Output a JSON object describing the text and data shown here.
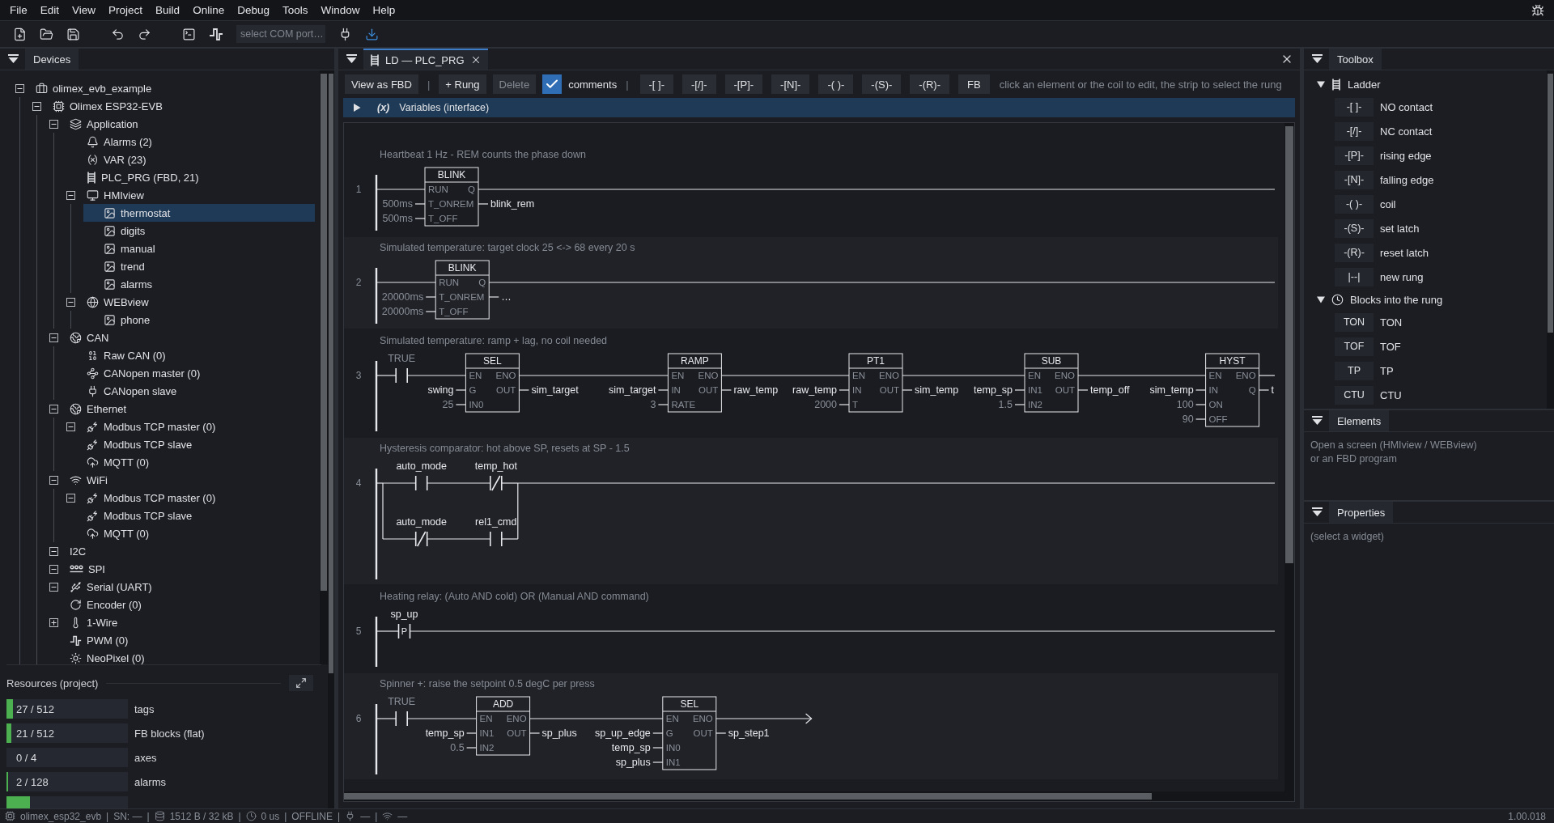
{
  "menu": [
    "File",
    "Edit",
    "View",
    "Project",
    "Build",
    "Online",
    "Debug",
    "Tools",
    "Window",
    "Help"
  ],
  "toolbar": {
    "port_select": {
      "placeholder": "select COM port…"
    }
  },
  "devices": {
    "title": "Devices",
    "tree": [
      {
        "label": "olimex_evb_example",
        "kind": "project",
        "expanded": true,
        "selected": false,
        "children": [
          {
            "label": "Olimex ESP32-EVB",
            "kind": "board",
            "expanded": true,
            "selected": false,
            "children": [
              {
                "label": "Application",
                "kind": "application",
                "expanded": true,
                "selected": false,
                "children": [
                  {
                    "label": "Alarms (2)",
                    "kind": "alarms",
                    "selected": false
                  },
                  {
                    "label": "VAR (23)",
                    "kind": "variables",
                    "selected": false
                  },
                  {
                    "label": "PLC_PRG (FBD, 21)",
                    "kind": "program",
                    "selected": false
                  },
                  {
                    "label": "HMIview",
                    "kind": "screens",
                    "expanded": true,
                    "selected": false,
                    "children": [
                      {
                        "label": "thermostat",
                        "kind": "screen",
                        "selected": true
                      },
                      {
                        "label": "digits",
                        "kind": "screen",
                        "selected": false
                      },
                      {
                        "label": "manual",
                        "kind": "screen",
                        "selected": false
                      },
                      {
                        "label": "trend",
                        "kind": "screen",
                        "selected": false
                      },
                      {
                        "label": "alarms",
                        "kind": "screen",
                        "selected": false
                      }
                    ]
                  },
                  {
                    "label": "WEBview",
                    "kind": "web",
                    "expanded": true,
                    "selected": false,
                    "children": [
                      {
                        "label": "phone",
                        "kind": "screen",
                        "selected": false
                      }
                    ]
                  }
                ]
              },
              {
                "label": "CAN",
                "kind": "bus",
                "expanded": true,
                "selected": false,
                "children": [
                  {
                    "label": "Raw CAN (0)",
                    "kind": "raw",
                    "selected": false
                  },
                  {
                    "label": "CANopen master (0)",
                    "kind": "master",
                    "selected": false
                  },
                  {
                    "label": "CANopen slave",
                    "kind": "slave",
                    "selected": false
                  }
                ]
              },
              {
                "label": "Ethernet",
                "kind": "bus",
                "expanded": true,
                "selected": false,
                "children": [
                  {
                    "label": "Modbus TCP master (0)",
                    "kind": "modbus",
                    "expanded": true,
                    "selected": false
                  },
                  {
                    "label": "Modbus TCP slave",
                    "kind": "modbus",
                    "selected": false
                  },
                  {
                    "label": "MQTT (0)",
                    "kind": "mqtt",
                    "selected": false
                  }
                ]
              },
              {
                "label": "WiFi",
                "kind": "wifi",
                "expanded": true,
                "selected": false,
                "children": [
                  {
                    "label": "Modbus TCP master (0)",
                    "kind": "modbus",
                    "expanded": true,
                    "selected": false
                  },
                  {
                    "label": "Modbus TCP slave",
                    "kind": "modbus",
                    "selected": false
                  },
                  {
                    "label": "MQTT (0)",
                    "kind": "mqtt",
                    "selected": false
                  }
                ]
              },
              {
                "label": "I2C",
                "kind": "interface",
                "expanded": true,
                "selected": false
              },
              {
                "label": "SPI",
                "kind": "spi",
                "expanded": true,
                "selected": false
              },
              {
                "label": "Serial (UART)",
                "kind": "serial",
                "expanded": true,
                "selected": false
              },
              {
                "label": "Encoder (0)",
                "kind": "encoder",
                "selected": false
              },
              {
                "label": "1-Wire",
                "kind": "onewire",
                "expanded": false,
                "selected": false
              },
              {
                "label": "PWM (0)",
                "kind": "pwm",
                "selected": false
              },
              {
                "label": "NeoPixel (0)",
                "kind": "led",
                "selected": false
              }
            ]
          }
        ]
      }
    ]
  },
  "resources": {
    "title": "Resources (project)",
    "items": [
      {
        "value": "27 / 512",
        "label": "tags",
        "level": 0.053
      },
      {
        "value": "21 / 512",
        "label": "FB blocks (flat)",
        "level": 0.041
      },
      {
        "value": "0 / 4",
        "label": "axes"
      },
      {
        "value": "2 / 128",
        "label": "alarms",
        "level": 0.016
      },
      {
        "level": 0.19
      }
    ]
  },
  "editor": {
    "tab": {
      "title": "LD — PLC_PRG",
      "selected": true
    },
    "toolbar": [
      {
        "kind": "button",
        "label": "View as FBD",
        "disabled": false
      },
      {
        "kind": "separator",
        "label": "|"
      },
      {
        "kind": "button",
        "label": "+ Rung",
        "disabled": false
      },
      {
        "kind": "button",
        "label": "Delete",
        "disabled": true
      },
      {
        "kind": "checkbox",
        "label": "comments",
        "checked": true
      },
      {
        "kind": "separator",
        "label": "|"
      },
      {
        "kind": "element",
        "label": "-[ ]-",
        "disabled": false
      },
      {
        "kind": "element",
        "label": "-[/]-",
        "disabled": false
      },
      {
        "kind": "element",
        "label": "-[P]-",
        "disabled": false
      },
      {
        "kind": "element",
        "label": "-[N]-",
        "disabled": false
      },
      {
        "kind": "element",
        "label": "-( )-",
        "disabled": false
      },
      {
        "kind": "element",
        "label": "-(S)-",
        "disabled": false
      },
      {
        "kind": "element",
        "label": "-(R)-",
        "disabled": false
      },
      {
        "kind": "element",
        "label": "FB",
        "disabled": false
      },
      {
        "kind": "hint",
        "label": "click an element or the coil to edit, the strip to select the rung"
      }
    ],
    "variables_bar": {
      "icon_text": "(x)",
      "label": "Variables (interface)",
      "expanded": false
    },
    "rungs": [
      {
        "number": "1",
        "comment": "Heartbeat 1 Hz - REM counts the phase down",
        "arrow_end": false,
        "elements": [
          {
            "kind": "block",
            "name": "BLINK",
            "rows": [
              {
                "in": "RUN",
                "out": "Q"
              },
              {
                "in": "T_ONREM",
                "input": "500ms",
                "literal": true,
                "output": "blink_rem"
              },
              {
                "in": "T_OFF",
                "input": "500ms",
                "literal": true
              }
            ]
          }
        ]
      },
      {
        "number": "2",
        "comment": "Simulated temperature: target clock 25 <-> 68 every 20 s",
        "arrow_end": false,
        "elements": [
          {
            "kind": "block",
            "name": "BLINK",
            "rows": [
              {
                "in": "RUN",
                "out": "Q"
              },
              {
                "in": "T_ONREM",
                "input": "20000ms",
                "literal": true,
                "output": "…"
              },
              {
                "in": "T_OFF",
                "input": "20000ms",
                "literal": true
              }
            ]
          }
        ]
      },
      {
        "number": "3",
        "comment": "Simulated temperature: ramp + lag, no coil needed",
        "arrow_end": false,
        "elements": [
          {
            "kind": "contact",
            "negated": false,
            "label": "TRUE",
            "literal": true
          },
          {
            "kind": "block",
            "name": "SEL",
            "rows": [
              {
                "in": "EN",
                "out": "ENO"
              },
              {
                "in": "G",
                "out": "OUT",
                "input": "swing",
                "literal": false,
                "output": "sim_target"
              },
              {
                "in": "IN0",
                "input": "25",
                "literal": true
              }
            ]
          },
          {
            "kind": "block",
            "name": "RAMP",
            "rows": [
              {
                "in": "EN",
                "out": "ENO"
              },
              {
                "in": "IN",
                "out": "OUT",
                "input": "sim_target",
                "literal": false,
                "output": "raw_temp"
              },
              {
                "in": "RATE",
                "input": "3",
                "literal": true
              }
            ]
          },
          {
            "kind": "block",
            "name": "PT1",
            "rows": [
              {
                "in": "EN",
                "out": "ENO"
              },
              {
                "in": "IN",
                "out": "OUT",
                "input": "raw_temp",
                "literal": false,
                "output": "sim_temp"
              },
              {
                "in": "T",
                "input": "2000",
                "literal": true
              }
            ]
          },
          {
            "kind": "block",
            "name": "SUB",
            "rows": [
              {
                "in": "EN",
                "out": "ENO"
              },
              {
                "in": "IN1",
                "out": "OUT",
                "input": "temp_sp",
                "literal": false,
                "output": "temp_off"
              },
              {
                "in": "IN2",
                "input": "1.5",
                "literal": true
              }
            ]
          },
          {
            "kind": "block",
            "name": "HYST",
            "rows": [
              {
                "in": "EN",
                "out": "ENO"
              },
              {
                "in": "IN",
                "out": "Q",
                "input": "sim_temp",
                "literal": false,
                "output": "t"
              },
              {
                "in": "ON",
                "input": "100",
                "literal": true
              },
              {
                "in": "OFF",
                "input": "90",
                "literal": true
              }
            ]
          }
        ]
      },
      {
        "number": "4",
        "comment": "Hysteresis comparator: hot above SP, resets at SP - 1.5",
        "arrow_end": false,
        "elements": [
          {
            "kind": "branch",
            "paths": [
              [
                {
                  "kind": "contact",
                  "negated": false,
                  "label": "auto_mode",
                  "literal": false
                },
                {
                  "kind": "contact",
                  "negated": true,
                  "label": "temp_hot",
                  "literal": false
                }
              ],
              [
                {
                  "kind": "contact",
                  "negated": true,
                  "label": "auto_mode",
                  "literal": false
                },
                {
                  "kind": "contact",
                  "negated": false,
                  "label": "rel1_cmd",
                  "literal": false
                }
              ]
            ]
          }
        ]
      },
      {
        "number": "5",
        "comment": "Heating relay: (Auto AND cold) OR (Manual AND command)",
        "arrow_end": false,
        "elements": [
          {
            "kind": "contact",
            "negated": false,
            "symbol": "P",
            "label": "sp_up",
            "literal": false
          }
        ]
      },
      {
        "number": "6",
        "comment": "Spinner +: raise the setpoint 0.5 degC per press",
        "arrow_end": true,
        "elements": [
          {
            "kind": "contact",
            "negated": false,
            "label": "TRUE",
            "literal": true
          },
          {
            "kind": "block",
            "name": "ADD",
            "rows": [
              {
                "in": "EN",
                "out": "ENO"
              },
              {
                "in": "IN1",
                "out": "OUT",
                "input": "temp_sp",
                "literal": false,
                "output": "sp_plus"
              },
              {
                "in": "IN2",
                "input": "0.5",
                "literal": true
              }
            ]
          },
          {
            "kind": "block",
            "name": "SEL",
            "rows": [
              {
                "in": "EN",
                "out": "ENO"
              },
              {
                "in": "G",
                "out": "OUT",
                "input": "sp_up_edge",
                "literal": false,
                "output": "sp_step1"
              },
              {
                "in": "IN0",
                "input": "temp_sp",
                "literal": false
              },
              {
                "in": "IN1",
                "input": "sp_plus",
                "literal": false
              }
            ]
          }
        ]
      }
    ]
  },
  "toolbox": {
    "title": "Toolbox",
    "groups": [
      {
        "label": "Ladder",
        "kind": "ladder",
        "expanded": true,
        "items": [
          {
            "key": "-[ ]-",
            "label": "NO contact"
          },
          {
            "key": "-[/]-",
            "label": "NC contact"
          },
          {
            "key": "-[P]-",
            "label": "rising edge"
          },
          {
            "key": "-[N]-",
            "label": "falling edge"
          },
          {
            "key": "-( )-",
            "label": "coil"
          },
          {
            "key": "-(S)-",
            "label": "set latch"
          },
          {
            "key": "-(R)-",
            "label": "reset latch"
          },
          {
            "key": "|--|",
            "label": "new rung"
          }
        ]
      },
      {
        "label": "Blocks into the rung",
        "kind": "timers",
        "expanded": true,
        "items": [
          {
            "key": "TON",
            "label": "TON"
          },
          {
            "key": "TOF",
            "label": "TOF"
          },
          {
            "key": "TP",
            "label": "TP"
          },
          {
            "key": "CTU",
            "label": "CTU"
          }
        ]
      }
    ]
  },
  "elements_panel": {
    "title": "Elements",
    "lines": [
      "Open a screen (HMIview / WEBview)",
      "or an FBD program"
    ]
  },
  "properties_panel": {
    "title": "Properties",
    "hint": "(select a widget)"
  },
  "status_bar": {
    "items": [
      {
        "kind": "device",
        "text": "olimex_esp32_evb"
      },
      {
        "kind": "separator",
        "text": "|"
      },
      {
        "kind": "plain",
        "text": "SN: —"
      },
      {
        "kind": "separator",
        "text": "|"
      },
      {
        "kind": "memory",
        "text": "1512 B / 32 kB"
      },
      {
        "kind": "separator",
        "text": "|"
      },
      {
        "kind": "cycle",
        "text": "0 us"
      },
      {
        "kind": "separator",
        "text": "|"
      },
      {
        "kind": "plain",
        "text": "OFFLINE"
      },
      {
        "kind": "separator",
        "text": "|"
      },
      {
        "kind": "connection",
        "text": "—"
      },
      {
        "kind": "separator",
        "text": "|"
      },
      {
        "kind": "wifi",
        "text": "—"
      }
    ],
    "version": "1.00.018"
  }
}
